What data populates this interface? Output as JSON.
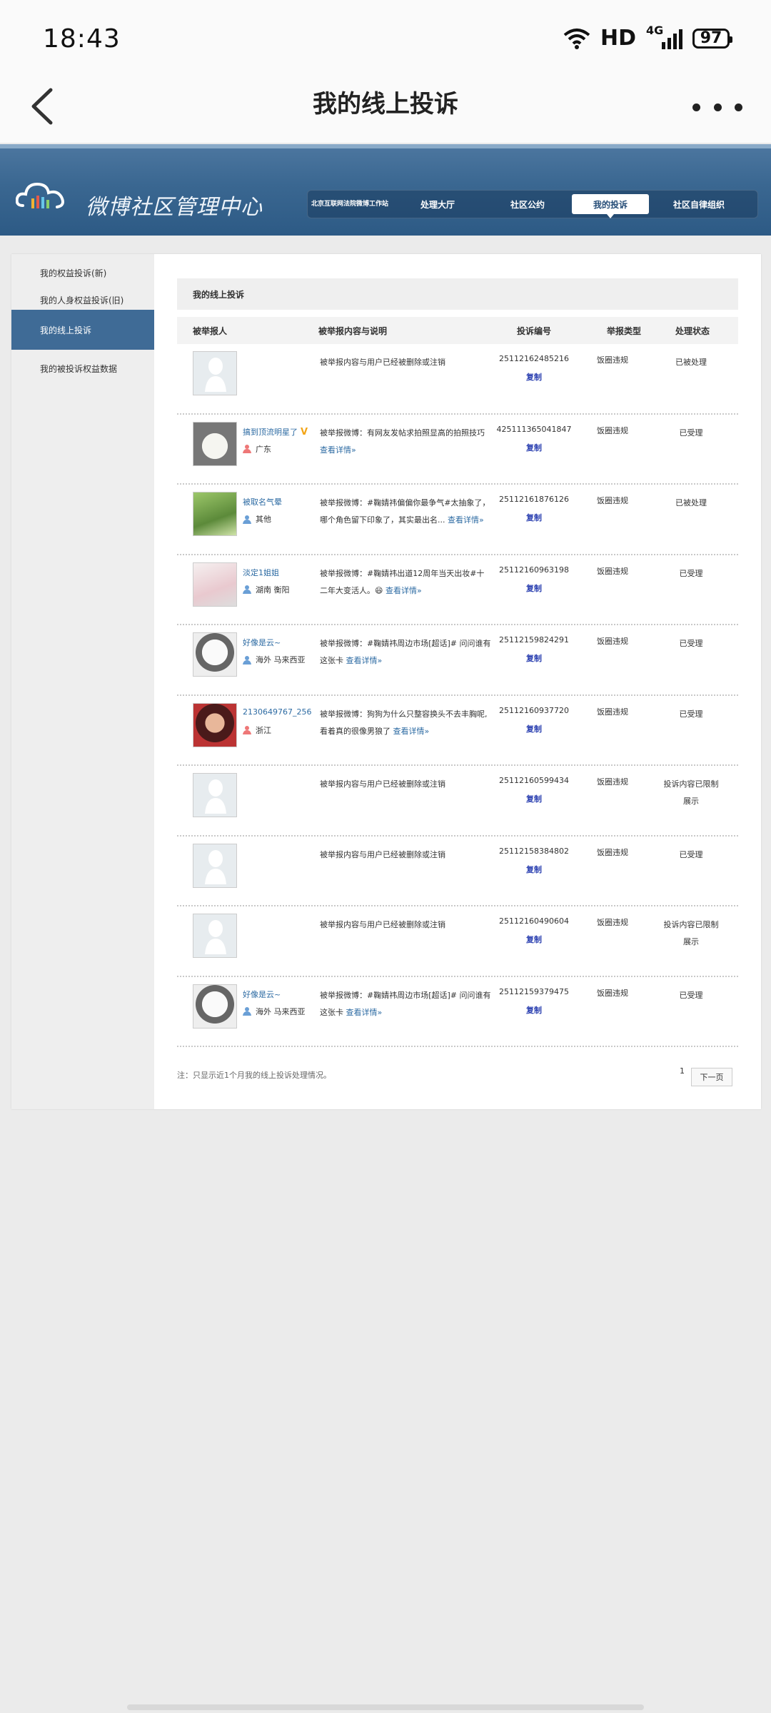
{
  "status": {
    "time": "18:43",
    "network": "HD",
    "cell": "4G",
    "battery": "97"
  },
  "app": {
    "title": "我的线上投诉"
  },
  "banner": {
    "logo_text": "微博社区管理中心",
    "nav": [
      "北京互联网法院微博工作站",
      "处理大厅",
      "社区公约",
      "我的投诉",
      "社区自律组织"
    ]
  },
  "sidebar": {
    "items": [
      "我的权益投诉(新)",
      "我的人身权益投诉(旧)",
      "我的线上投诉",
      "我的被投诉权益数据"
    ]
  },
  "content": {
    "header": "我的线上投诉",
    "columns": [
      "被举报人",
      "被举报内容与说明",
      "投诉编号",
      "举报类型",
      "处理状态"
    ],
    "copy_label": "复制",
    "rows": [
      {
        "user": "",
        "location": "",
        "desc": "被举报内容与用户已经被删除或注销",
        "link": "",
        "number": "25112162485216",
        "type": "饭圈违规",
        "status": "已被处理"
      },
      {
        "user": "搞到顶流明星了",
        "location": "广东",
        "desc": "被举报微博：有网友发帖求拍照显高的拍照技巧",
        "link": "查看详情»",
        "number": "425111365041847",
        "type": "饭圈违规",
        "status": "已受理"
      },
      {
        "user": "被取名气晕",
        "location": "其他",
        "desc": "被举报微博：#鞠婧祎偏偏你最争气#太抽象了，哪个角色留下印象了，其实最出名...",
        "link": "查看详情»",
        "number": "25112161876126",
        "type": "饭圈违规",
        "status": "已被处理"
      },
      {
        "user": "淡定1姐姐",
        "location": "湖南 衡阳",
        "desc": "被举报微博：#鞠婧祎出道12周年当天出妆#十二年大变活人。😄",
        "link": "查看详情»",
        "number": "25112160963198",
        "type": "饭圈违规",
        "status": "已受理"
      },
      {
        "user": "好像是云~",
        "location": "海外 马来西亚",
        "desc": "被举报微博：#鞠婧祎周边市场[超话]# 问问谁有这张卡",
        "link": "查看详情»",
        "number": "25112159824291",
        "type": "饭圈违规",
        "status": "已受理"
      },
      {
        "user": "2130649767_256",
        "location": "浙江",
        "desc": "被举报微博：狗狗为什么只整容换头不去丰胸呢,看着真的很像男狼了",
        "link": "查看详情»",
        "number": "25112160937720",
        "type": "饭圈违规",
        "status": "已受理"
      },
      {
        "user": "",
        "location": "",
        "desc": "被举报内容与用户已经被删除或注销",
        "link": "",
        "number": "25112160599434",
        "type": "饭圈违规",
        "status": "投诉内容已限制展示"
      },
      {
        "user": "",
        "location": "",
        "desc": "被举报内容与用户已经被删除或注销",
        "link": "",
        "number": "25112158384802",
        "type": "饭圈违规",
        "status": "已受理"
      },
      {
        "user": "",
        "location": "",
        "desc": "被举报内容与用户已经被删除或注销",
        "link": "",
        "number": "25112160490604",
        "type": "饭圈违规",
        "status": "投诉内容已限制展示"
      },
      {
        "user": "好像是云~",
        "location": "海外 马来西亚",
        "desc": "被举报微博：#鞠婧祎周边市场[超话]# 问问谁有这张卡",
        "link": "查看详情»",
        "number": "25112159379475",
        "type": "饭圈违规",
        "status": "已受理"
      }
    ],
    "note": "注：只显示近1个月我的线上投诉处理情况。",
    "pager": {
      "current": "1",
      "next": "下一页"
    }
  },
  "colors": {
    "banner": "#3a6791",
    "active_sidebar": "#3f6b96",
    "link": "#2d6ba3",
    "copy": "#2a3fb0",
    "vip_badge": "#f3a517"
  }
}
